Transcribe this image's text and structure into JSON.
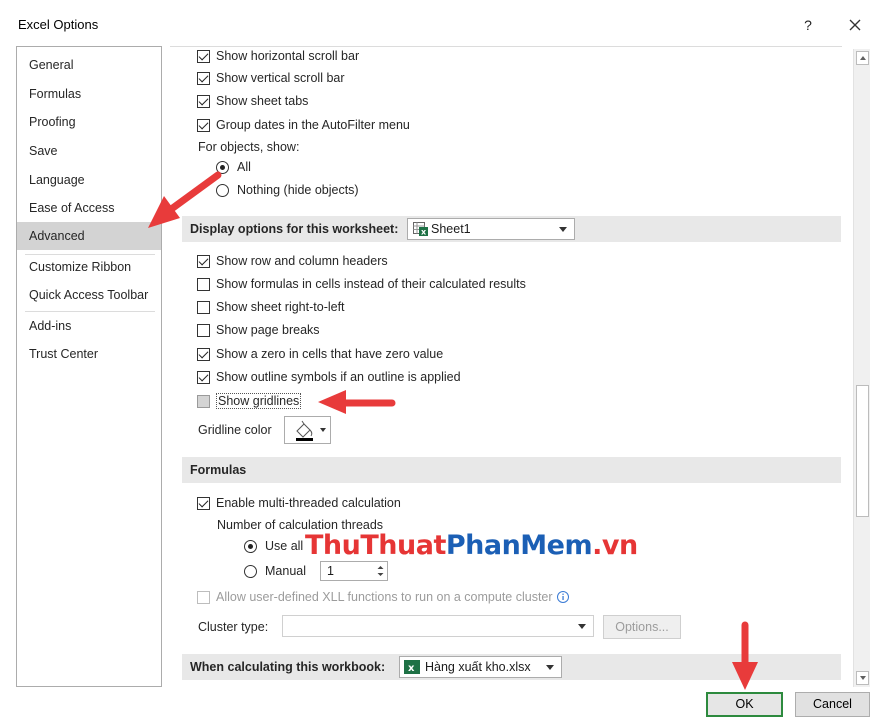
{
  "window": {
    "title": "Excel Options",
    "help_label": "?",
    "close_icon": "close-icon"
  },
  "sidebar": {
    "items": [
      {
        "label": "General"
      },
      {
        "label": "Formulas"
      },
      {
        "label": "Proofing"
      },
      {
        "label": "Save"
      },
      {
        "label": "Language"
      },
      {
        "label": "Ease of Access"
      },
      {
        "label": "Advanced",
        "selected": true
      },
      {
        "label": "Customize Ribbon"
      },
      {
        "label": "Quick Access Toolbar"
      },
      {
        "label": "Add-ins"
      },
      {
        "label": "Trust Center"
      }
    ]
  },
  "workbook_options": {
    "show_horizontal_scroll_bar": {
      "label": "Show horizontal scroll bar",
      "checked": true
    },
    "show_vertical_scroll_bar": {
      "label": "Show vertical scroll bar",
      "checked": true
    },
    "show_sheet_tabs": {
      "label": "Show sheet tabs",
      "checked": true
    },
    "group_dates": {
      "label": "Group dates in the AutoFilter menu",
      "checked": true
    },
    "for_objects_label": "For objects, show:",
    "objects_all": {
      "label": "All",
      "selected": true
    },
    "objects_nothing": {
      "label": "Nothing (hide objects)",
      "selected": false
    }
  },
  "worksheet_section": {
    "header": "Display options for this worksheet:",
    "sheet_select": {
      "value": "Sheet1",
      "icon": "excel-sheet-icon"
    },
    "show_row_column_headers": {
      "label": "Show row and column headers",
      "checked": true
    },
    "show_formulas": {
      "label": "Show formulas in cells instead of their calculated results",
      "checked": false
    },
    "show_sheet_rtl": {
      "label": "Show sheet right-to-left",
      "checked": false
    },
    "show_page_breaks": {
      "label": "Show page breaks",
      "checked": false
    },
    "show_zero": {
      "label": "Show a zero in cells that have zero value",
      "checked": true
    },
    "show_outline": {
      "label": "Show outline symbols if an outline is applied",
      "checked": true
    },
    "show_gridlines": {
      "label": "Show gridlines",
      "checked": false
    },
    "gridline_color_label": "Gridline color",
    "gridline_color_icon": "paint-bucket-icon"
  },
  "formulas_section": {
    "header": "Formulas",
    "enable_multithreaded": {
      "label": "Enable multi-threaded calculation",
      "checked": true
    },
    "threads_label": "Number of calculation threads",
    "use_all_label": "Use all",
    "manual_label": "Manual",
    "manual_value": "1",
    "allow_xll": {
      "label": "Allow user-defined XLL functions to run on a compute cluster",
      "checked": false,
      "disabled": true
    },
    "cluster_type_label": "Cluster type:",
    "cluster_type_value": "",
    "options_button": "Options..."
  },
  "calc_section": {
    "header": "When calculating this workbook:",
    "workbook_select": {
      "value": "Hàng xuất kho.xlsx",
      "icon": "excel-file-icon"
    }
  },
  "footer": {
    "ok_label": "OK",
    "cancel_label": "Cancel"
  },
  "watermark": {
    "part1": "ThuThuat",
    "part2": "PhanMem",
    "part3": ".vn"
  },
  "colors": {
    "annotation_arrow": "#e83b3b",
    "ok_border": "#2d8a3e",
    "selected_sidebar": "#d3d3d3",
    "section_header_bg": "#e8e8e8"
  }
}
